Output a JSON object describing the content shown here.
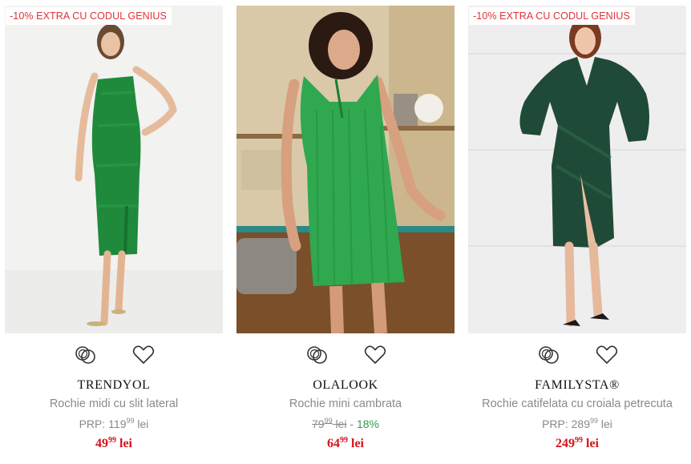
{
  "products": [
    {
      "badge": "-10% EXTRA CU CODUL GENIUS",
      "brand": "TRENDYOL",
      "title": "Rochie midi cu slit lateral",
      "prp_label": "PRP:",
      "prp_int": "119",
      "prp_dec": "99",
      "prp_unit": "lei",
      "price_int": "49",
      "price_dec": "99",
      "price_unit": "lei",
      "image_icon": "product-photo-green-midi-dress"
    },
    {
      "badge": "",
      "brand": "OLALOOK",
      "title": "Rochie mini cambrata",
      "old_int": "79",
      "old_dec": "99",
      "old_unit": "lei",
      "discount_sep": " - ",
      "discount": "18%",
      "price_int": "64",
      "price_dec": "99",
      "price_unit": "lei",
      "image_icon": "product-photo-green-ribbed-mini-dress"
    },
    {
      "badge": "-10% EXTRA CU CODUL GENIUS",
      "brand": "FAMILYSTA®",
      "title": "Rochie catifelata cu croiala petrecuta",
      "prp_label": "PRP:",
      "prp_int": "289",
      "prp_dec": "99",
      "prp_unit": "lei",
      "price_int": "249",
      "price_dec": "99",
      "price_unit": "lei",
      "image_icon": "product-photo-green-velvet-wrap-dress"
    }
  ],
  "icons": {
    "compare": "compare-rings-icon",
    "favorite": "heart-icon"
  },
  "colors": {
    "badge_text": "#e0313a",
    "price": "#d4141c",
    "discount": "#2e9c4a",
    "muted_text": "#8a8a8a"
  }
}
